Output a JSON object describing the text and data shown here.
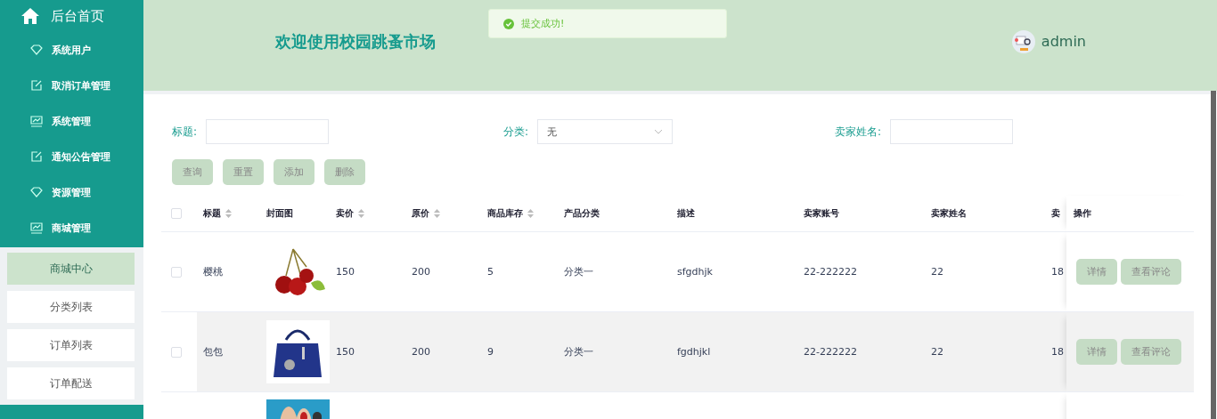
{
  "sidebar": {
    "home": "后台首页",
    "items": [
      {
        "label": "系统用户"
      },
      {
        "label": "取消订单管理"
      },
      {
        "label": "系统管理"
      },
      {
        "label": "通知公告管理"
      },
      {
        "label": "资源管理"
      },
      {
        "label": "商城管理"
      }
    ],
    "submenu": [
      {
        "label": "商城中心",
        "selected": true
      },
      {
        "label": "分类列表",
        "selected": false
      },
      {
        "label": "订单列表",
        "selected": false
      },
      {
        "label": "订单配送",
        "selected": false
      }
    ]
  },
  "header": {
    "title": "欢迎使用校园跳蚤市场",
    "user": "admin"
  },
  "toast": {
    "message": "提交成功!"
  },
  "search": {
    "fields": [
      {
        "label": "标题:",
        "kind": "input"
      },
      {
        "label": "分类:",
        "kind": "select",
        "value": "无"
      },
      {
        "label": "卖家姓名:",
        "kind": "input"
      }
    ],
    "buttons": [
      "查询",
      "重置",
      "添加",
      "删除"
    ]
  },
  "table": {
    "select_all": {
      "checked": false
    },
    "columns": [
      {
        "label": "标题",
        "sortable": true,
        "kind": "text"
      },
      {
        "label": "封面图",
        "sortable": false
      },
      {
        "label": "卖价",
        "sortable": true,
        "kind": "text"
      },
      {
        "label": "原价",
        "sortable": true,
        "kind": "text"
      },
      {
        "label": "商品库存",
        "sortable": true,
        "kind": "text"
      },
      {
        "label": "产品分类",
        "sortable": false,
        "kind": "text"
      },
      {
        "label": "描述",
        "sortable": false,
        "kind": "text"
      },
      {
        "label": "卖家账号",
        "sortable": false,
        "kind": "text"
      },
      {
        "label": "卖家姓名",
        "sortable": false,
        "kind": "text"
      },
      {
        "label": "卖",
        "sortable": false,
        "kind": "text"
      },
      {
        "label": "操作",
        "sortable": false,
        "kind": "actions"
      }
    ],
    "rows": [
      {
        "checked": false,
        "highlighted": false,
        "cells": [
          "樱桃",
          {
            "kind": "picture"
          },
          "150",
          "200",
          "5",
          "分类一",
          "sfgdhjk",
          "22-222222",
          "22",
          "18"
        ],
        "actions": [
          "详情",
          "查看评论"
        ]
      },
      {
        "checked": false,
        "highlighted": true,
        "cells": [
          "包包",
          {
            "kind": "picture"
          },
          "150",
          "200",
          "9",
          "分类一",
          "fgdhjkl",
          "22-222222",
          "22",
          "18"
        ],
        "actions": [
          "详情",
          "查看评论"
        ]
      },
      {
        "cells": [
          null,
          {
            "kind": "picture"
          }
        ]
      }
    ]
  }
}
